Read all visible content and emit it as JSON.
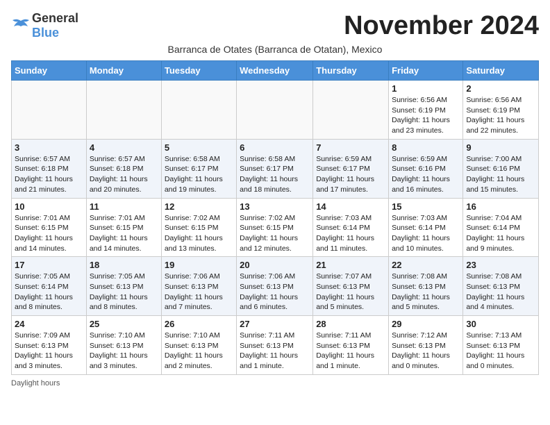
{
  "logo": {
    "general": "General",
    "blue": "Blue"
  },
  "title": "November 2024",
  "subtitle": "Barranca de Otates (Barranca de Otatan), Mexico",
  "days_of_week": [
    "Sunday",
    "Monday",
    "Tuesday",
    "Wednesday",
    "Thursday",
    "Friday",
    "Saturday"
  ],
  "footer": "Daylight hours",
  "weeks": [
    [
      {
        "day": "",
        "info": ""
      },
      {
        "day": "",
        "info": ""
      },
      {
        "day": "",
        "info": ""
      },
      {
        "day": "",
        "info": ""
      },
      {
        "day": "",
        "info": ""
      },
      {
        "day": "1",
        "info": "Sunrise: 6:56 AM\nSunset: 6:19 PM\nDaylight: 11 hours and 23 minutes."
      },
      {
        "day": "2",
        "info": "Sunrise: 6:56 AM\nSunset: 6:19 PM\nDaylight: 11 hours and 22 minutes."
      }
    ],
    [
      {
        "day": "3",
        "info": "Sunrise: 6:57 AM\nSunset: 6:18 PM\nDaylight: 11 hours and 21 minutes."
      },
      {
        "day": "4",
        "info": "Sunrise: 6:57 AM\nSunset: 6:18 PM\nDaylight: 11 hours and 20 minutes."
      },
      {
        "day": "5",
        "info": "Sunrise: 6:58 AM\nSunset: 6:17 PM\nDaylight: 11 hours and 19 minutes."
      },
      {
        "day": "6",
        "info": "Sunrise: 6:58 AM\nSunset: 6:17 PM\nDaylight: 11 hours and 18 minutes."
      },
      {
        "day": "7",
        "info": "Sunrise: 6:59 AM\nSunset: 6:17 PM\nDaylight: 11 hours and 17 minutes."
      },
      {
        "day": "8",
        "info": "Sunrise: 6:59 AM\nSunset: 6:16 PM\nDaylight: 11 hours and 16 minutes."
      },
      {
        "day": "9",
        "info": "Sunrise: 7:00 AM\nSunset: 6:16 PM\nDaylight: 11 hours and 15 minutes."
      }
    ],
    [
      {
        "day": "10",
        "info": "Sunrise: 7:01 AM\nSunset: 6:15 PM\nDaylight: 11 hours and 14 minutes."
      },
      {
        "day": "11",
        "info": "Sunrise: 7:01 AM\nSunset: 6:15 PM\nDaylight: 11 hours and 14 minutes."
      },
      {
        "day": "12",
        "info": "Sunrise: 7:02 AM\nSunset: 6:15 PM\nDaylight: 11 hours and 13 minutes."
      },
      {
        "day": "13",
        "info": "Sunrise: 7:02 AM\nSunset: 6:15 PM\nDaylight: 11 hours and 12 minutes."
      },
      {
        "day": "14",
        "info": "Sunrise: 7:03 AM\nSunset: 6:14 PM\nDaylight: 11 hours and 11 minutes."
      },
      {
        "day": "15",
        "info": "Sunrise: 7:03 AM\nSunset: 6:14 PM\nDaylight: 11 hours and 10 minutes."
      },
      {
        "day": "16",
        "info": "Sunrise: 7:04 AM\nSunset: 6:14 PM\nDaylight: 11 hours and 9 minutes."
      }
    ],
    [
      {
        "day": "17",
        "info": "Sunrise: 7:05 AM\nSunset: 6:14 PM\nDaylight: 11 hours and 8 minutes."
      },
      {
        "day": "18",
        "info": "Sunrise: 7:05 AM\nSunset: 6:13 PM\nDaylight: 11 hours and 8 minutes."
      },
      {
        "day": "19",
        "info": "Sunrise: 7:06 AM\nSunset: 6:13 PM\nDaylight: 11 hours and 7 minutes."
      },
      {
        "day": "20",
        "info": "Sunrise: 7:06 AM\nSunset: 6:13 PM\nDaylight: 11 hours and 6 minutes."
      },
      {
        "day": "21",
        "info": "Sunrise: 7:07 AM\nSunset: 6:13 PM\nDaylight: 11 hours and 5 minutes."
      },
      {
        "day": "22",
        "info": "Sunrise: 7:08 AM\nSunset: 6:13 PM\nDaylight: 11 hours and 5 minutes."
      },
      {
        "day": "23",
        "info": "Sunrise: 7:08 AM\nSunset: 6:13 PM\nDaylight: 11 hours and 4 minutes."
      }
    ],
    [
      {
        "day": "24",
        "info": "Sunrise: 7:09 AM\nSunset: 6:13 PM\nDaylight: 11 hours and 3 minutes."
      },
      {
        "day": "25",
        "info": "Sunrise: 7:10 AM\nSunset: 6:13 PM\nDaylight: 11 hours and 3 minutes."
      },
      {
        "day": "26",
        "info": "Sunrise: 7:10 AM\nSunset: 6:13 PM\nDaylight: 11 hours and 2 minutes."
      },
      {
        "day": "27",
        "info": "Sunrise: 7:11 AM\nSunset: 6:13 PM\nDaylight: 11 hours and 1 minute."
      },
      {
        "day": "28",
        "info": "Sunrise: 7:11 AM\nSunset: 6:13 PM\nDaylight: 11 hours and 1 minute."
      },
      {
        "day": "29",
        "info": "Sunrise: 7:12 AM\nSunset: 6:13 PM\nDaylight: 11 hours and 0 minutes."
      },
      {
        "day": "30",
        "info": "Sunrise: 7:13 AM\nSunset: 6:13 PM\nDaylight: 11 hours and 0 minutes."
      }
    ]
  ]
}
